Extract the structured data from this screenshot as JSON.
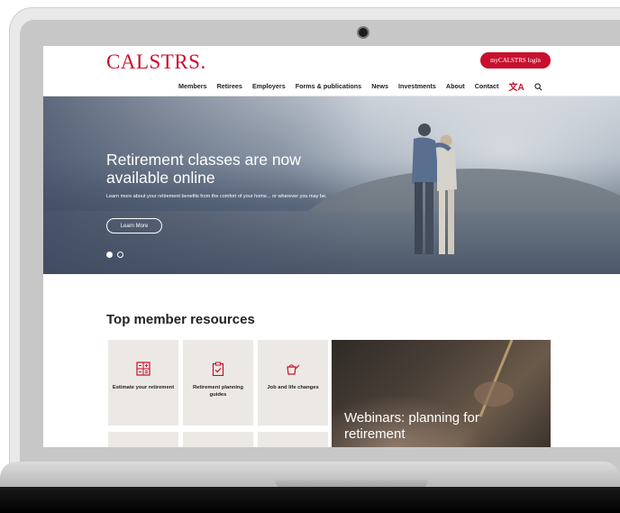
{
  "header": {
    "logo": "CALSTRS.",
    "login_label": "myCALSTRS login",
    "nav": [
      "Members",
      "Retirees",
      "Employers",
      "Forms & publications",
      "News",
      "Investments",
      "About",
      "Contact"
    ],
    "lang_icon": "translate-icon",
    "search_icon": "search-icon"
  },
  "hero": {
    "title": "Retirement classes are now available online",
    "subtitle": "Learn more about your retirement benefits from the comfort of your home... or wherever you may be.",
    "cta": "Learn More",
    "slides": {
      "current": 1,
      "total": 2
    }
  },
  "resources": {
    "heading": "Top member resources",
    "tiles": [
      {
        "label": "Estimate your retirement",
        "icon": "calculator-icon"
      },
      {
        "label": "Retirement planning guides",
        "icon": "clipboard-check-icon"
      },
      {
        "label": "Job and life changes",
        "icon": "watering-can-icon"
      }
    ],
    "feature": "Webinars: planning for retirement"
  },
  "colors": {
    "brand": "#c8102e",
    "tile_bg": "#ece9e5"
  }
}
